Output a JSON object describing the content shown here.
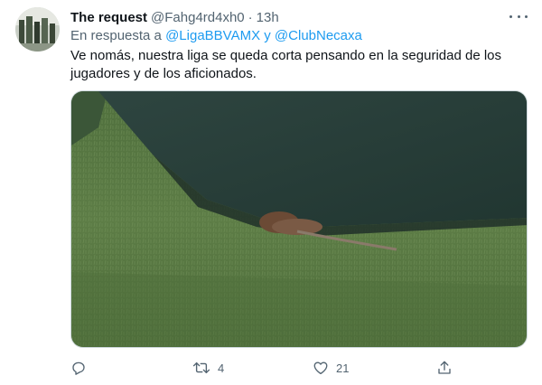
{
  "tweet": {
    "display_name": "The request",
    "handle": "@Fahg4rd4xh0",
    "separator": "·",
    "time": "13h",
    "replying_prefix": "En respuesta a",
    "mention_1": "@LigaBBVAMX",
    "replying_conjunction": "y",
    "mention_2": "@ClubNecaxa",
    "text": "Ve nomás, nuestra liga se queda corta pensando en la seguridad de los jugadores y de los aficionados."
  },
  "actions": {
    "reply_icon": "reply-icon",
    "retweet_icon": "retweet-icon",
    "retweet_count": "4",
    "like_icon": "heart-icon",
    "like_count": "21",
    "share_icon": "share-icon"
  },
  "colors": {
    "accent": "#1d9bf0",
    "secondary_text": "#536471",
    "primary_text": "#0f1419"
  }
}
